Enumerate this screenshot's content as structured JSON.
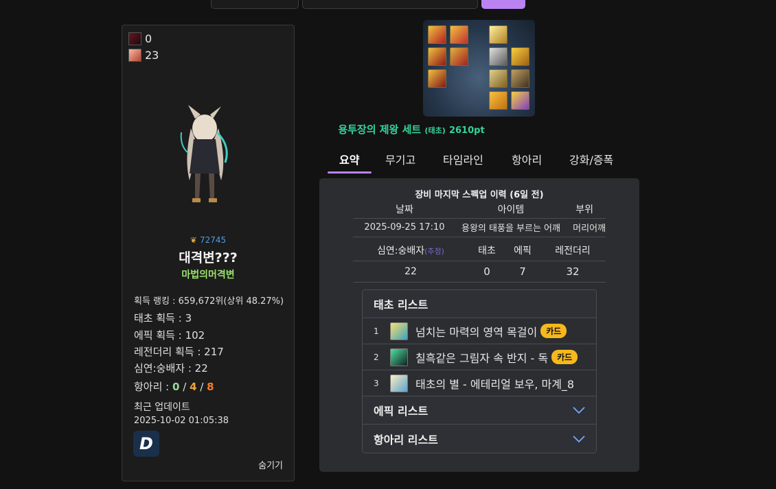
{
  "profile": {
    "mini_stats": [
      {
        "icon": "dark-item-icon",
        "value": "0"
      },
      {
        "icon": "pink-item-icon",
        "value": "23"
      }
    ],
    "fame": "72745",
    "name": "대격변???",
    "class": "마법의머격변",
    "rank_label": "획득 랭킹 : ",
    "rank_value": "659,672위(상위 48.27%)",
    "taecho_label": "태초 획득 : ",
    "taecho_value": "3",
    "epic_label": "에픽 획득 : ",
    "epic_value": "102",
    "legend_label": "레전더리 획득 : ",
    "legend_value": "217",
    "simyeon_label": "심연:숭배자 : ",
    "simyeon_value": "22",
    "hangari_label": "항아리 : ",
    "hangari_values": [
      "0",
      "4",
      "8"
    ],
    "hangari_sep": "/",
    "update_label": "최근 업데이트",
    "update_time": "2025-10-02 01:05:38",
    "logo_letter": "D",
    "hide_label": "숨기기"
  },
  "set": {
    "name": "용투장의 제왕 세트",
    "sub": "(태초)",
    "points": "2610pt"
  },
  "tabs": [
    "요약",
    "무기고",
    "타임라인",
    "항아리",
    "강화/증폭"
  ],
  "summary": {
    "spec_title": "장비 마지막 스펙업 이력 (6일 전)",
    "history_headers": [
      "날짜",
      "아이템",
      "부위"
    ],
    "history_rows": [
      {
        "date": "2025-09-25 17:10",
        "item": "용왕의 태풍을 부르는 어깨",
        "slot": "머리어깨"
      }
    ],
    "count_headers": {
      "simyeon": "심연:숭배자",
      "estimate": "(추정)",
      "taecho": "태초",
      "epic": "에픽",
      "legend": "레전더리"
    },
    "counts": {
      "simyeon": "22",
      "taecho": "0",
      "epic": "7",
      "legend": "32"
    },
    "taecho_list_title": "태초 리스트",
    "taecho_list": [
      {
        "num": "1",
        "name": "넘치는 마력의 영역 목걸이",
        "badge": "카드"
      },
      {
        "num": "2",
        "name": "칠흑같은 그림자 속 반지 - 독",
        "badge": "카드"
      },
      {
        "num": "3",
        "name": "태초의 별 - 에테리얼 보우, 마계_8",
        "badge": ""
      }
    ],
    "epic_list_title": "에픽 리스트",
    "hangari_list_title": "항아리 리스트"
  },
  "colors": {
    "accent": "#b983f2",
    "set_green": "#35d49a",
    "badge": "#f6b81c",
    "orange": "#f2a33a",
    "class_green": "#9ae36a"
  }
}
